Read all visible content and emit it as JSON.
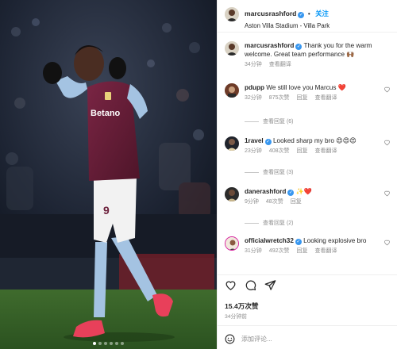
{
  "photo": {
    "kit_sponsor": "Betano",
    "shirt_number": "9",
    "carousel": {
      "count": 6,
      "active_index": 0
    }
  },
  "header": {
    "username": "marcusrashford",
    "follow_label": "关注",
    "location": "Aston Villa Stadium - Villa Park"
  },
  "caption": {
    "username": "marcusrashford",
    "text": "Thank you for the warm welcome. Great team performance 🙌🏾",
    "time": "34分钟",
    "translate": "查看翻译"
  },
  "comments": [
    {
      "username": "pdupp",
      "text": "We still love you Marcus ❤️",
      "time": "32分钟",
      "likes": "875次赞",
      "reply": "回复",
      "translate": "查看翻译",
      "replies": "查看回复 (6)"
    },
    {
      "username": "1ravel",
      "text": "Looked sharp my bro 😍😍😍",
      "time": "23分钟",
      "likes": "408次赞",
      "reply": "回复",
      "translate": "查看翻译",
      "replies": "查看回复 (3)"
    },
    {
      "username": "danerashford",
      "text": "✨❤️",
      "time": "9分钟",
      "likes": "48次赞",
      "reply": "回复",
      "replies": "查看回复 (2)"
    },
    {
      "username": "officialwretch32",
      "text": "Looking explosive bro",
      "time": "31分钟",
      "likes": "492次赞",
      "reply": "回复",
      "translate": "查看翻译"
    }
  ],
  "icons": {
    "like": "heart-outline-icon",
    "comment": "speech-bubble-icon",
    "share": "paper-plane-icon",
    "emoji": "smiley-icon",
    "verified": "verified-badge-icon"
  },
  "stats": {
    "likes": "15.4万次赞",
    "posted_ago": "34分钟前"
  },
  "add_comment": {
    "placeholder": "添加评论..."
  },
  "colors": {
    "link_blue": "#0095f6",
    "verified_blue": "#3897f0",
    "shirt_claret": "#6b1f3a",
    "sky_blue": "#a4c3e2"
  }
}
